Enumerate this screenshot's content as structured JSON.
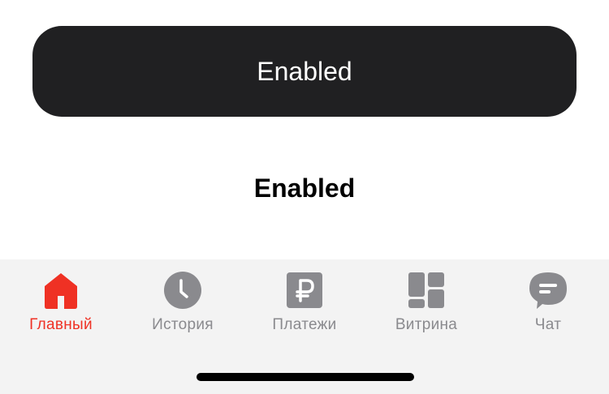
{
  "buttons": {
    "primary_label": "Enabled",
    "secondary_label": "Enabled"
  },
  "tabbar": {
    "tabs": [
      {
        "label": "Главный",
        "icon": "home-icon",
        "active": true
      },
      {
        "label": "История",
        "icon": "clock-icon",
        "active": false
      },
      {
        "label": "Платежи",
        "icon": "ruble-icon",
        "active": false
      },
      {
        "label": "Витрина",
        "icon": "grid-icon",
        "active": false
      },
      {
        "label": "Чат",
        "icon": "chat-icon",
        "active": false
      }
    ]
  },
  "colors": {
    "accent": "#ef3124",
    "inactive": "#8a8a8e",
    "button_dark": "#202022",
    "tabbar_bg": "#f3f3f3"
  }
}
